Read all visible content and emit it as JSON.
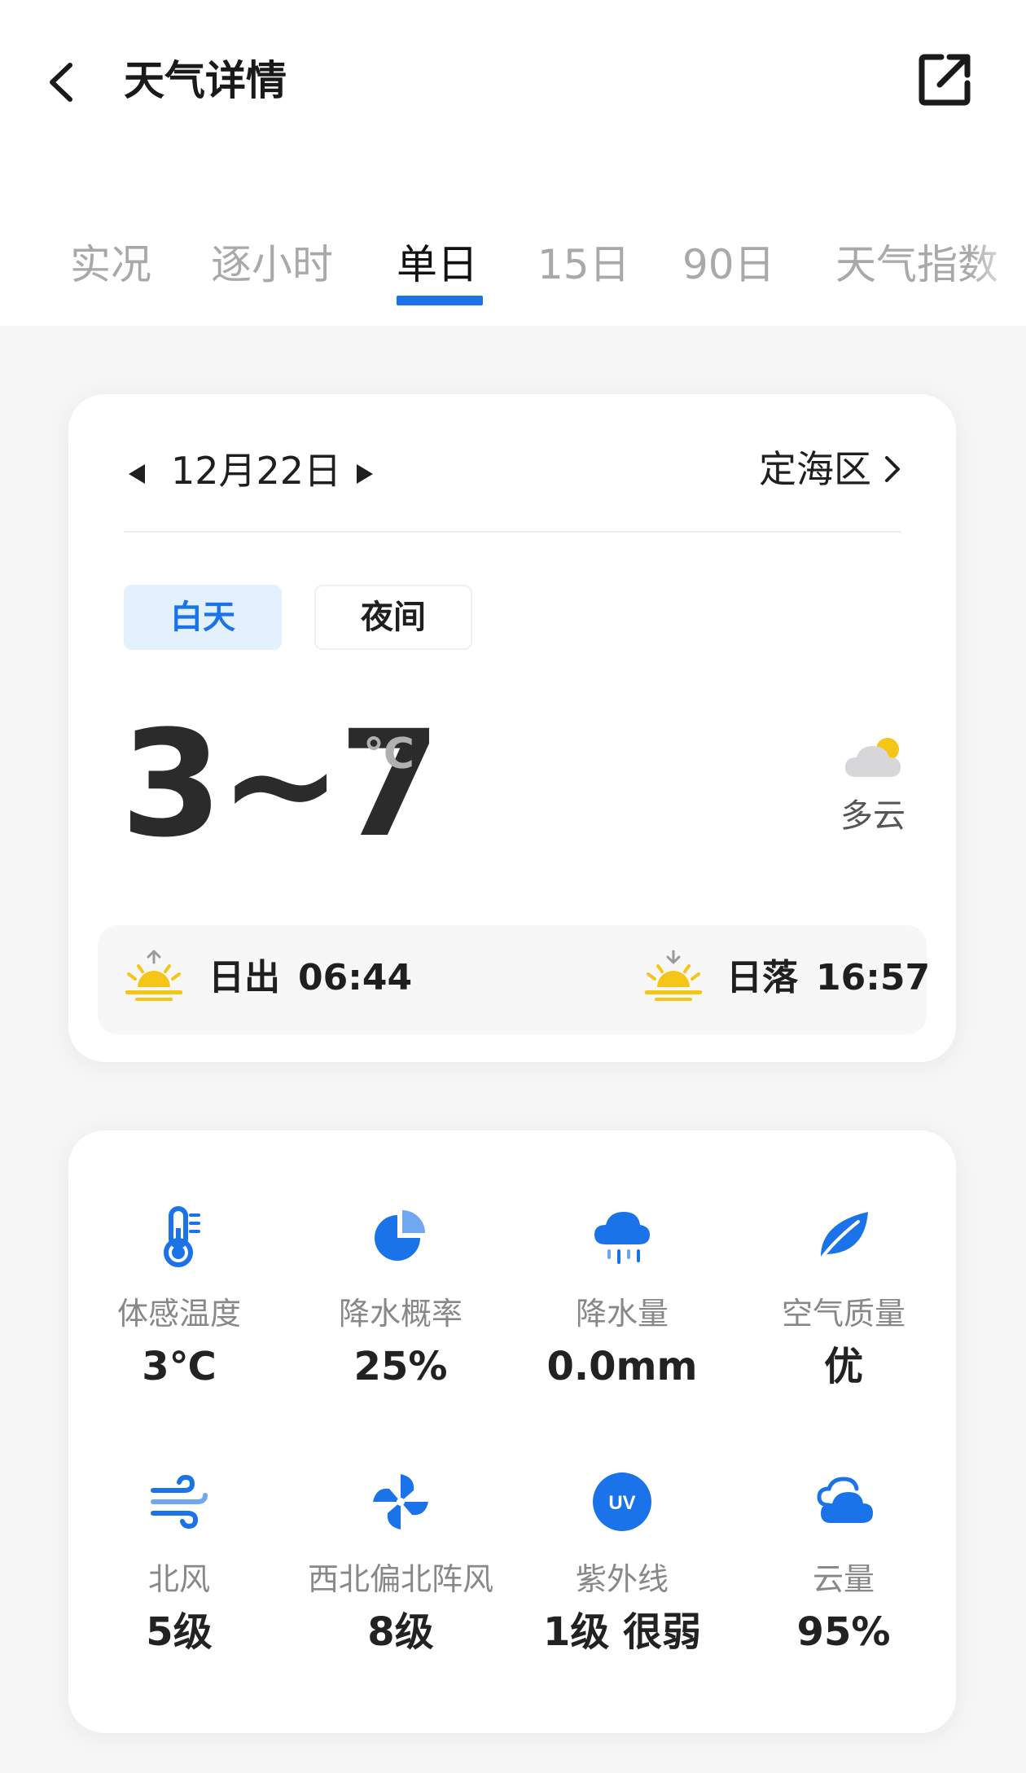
{
  "header": {
    "title": "天气详情"
  },
  "tabs": [
    {
      "label": "实况"
    },
    {
      "label": "逐小时"
    },
    {
      "label": "单日"
    },
    {
      "label": "15日"
    },
    {
      "label": "90日"
    },
    {
      "label": "天气指数"
    }
  ],
  "active_tab": "单日",
  "summary": {
    "date": "12月22日",
    "location": "定海区",
    "segments": {
      "day": "白天",
      "night": "夜间"
    },
    "selected_segment": "白天",
    "temperature": "3~7",
    "temperature_unit": "℃",
    "condition": "多云",
    "sunrise_label": "日出",
    "sunrise_time": "06:44",
    "sunset_label": "日落",
    "sunset_time": "16:57"
  },
  "metrics": [
    {
      "label": "体感温度",
      "value": "3℃",
      "icon": "thermometer-icon"
    },
    {
      "label": "降水概率",
      "value": "25%",
      "icon": "pie-chart-icon"
    },
    {
      "label": "降水量",
      "value": "0.0mm",
      "icon": "rain-cloud-icon"
    },
    {
      "label": "空气质量",
      "value": "优",
      "icon": "leaf-icon"
    },
    {
      "label": "北风",
      "value": "5级",
      "icon": "wind-icon"
    },
    {
      "label": "西北偏北阵风",
      "value": "8级",
      "icon": "pinwheel-icon"
    },
    {
      "label": "紫外线",
      "value": "1级 很弱",
      "icon": "uv-icon"
    },
    {
      "label": "云量",
      "value": "95%",
      "icon": "cloud-icon"
    }
  ],
  "uv_badge": "UV",
  "colors": {
    "accent": "#1a73e8",
    "accent_light": "#e3f0fd",
    "sun": "#f5c518"
  }
}
